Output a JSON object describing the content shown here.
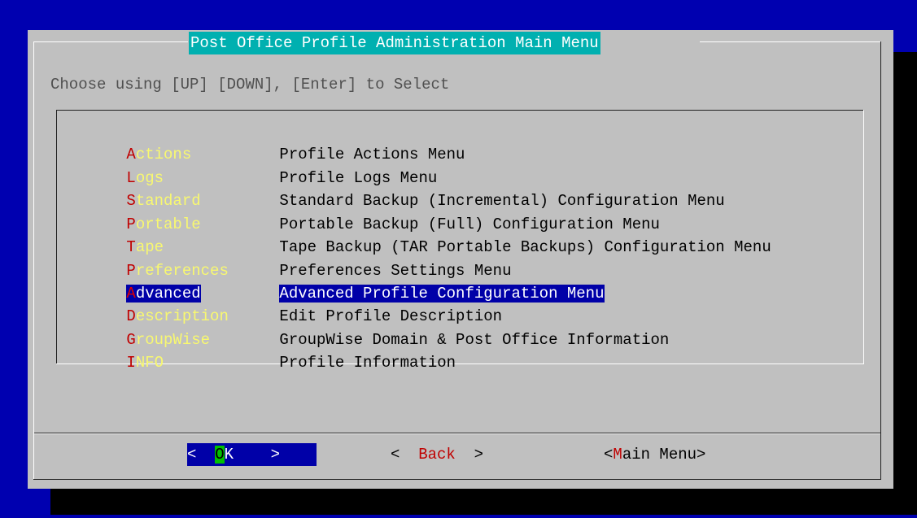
{
  "dialog": {
    "title": "Post Office Profile Administration Main Menu",
    "prompt": "Choose using [UP] [DOWN], [Enter] to Select"
  },
  "menu": {
    "selected_index": 6,
    "items": [
      {
        "hot": "A",
        "rest": "ctions",
        "desc": "Profile Actions Menu"
      },
      {
        "hot": "L",
        "rest": "ogs",
        "desc": "Profile Logs Menu"
      },
      {
        "hot": "S",
        "rest": "tandard",
        "desc": "Standard Backup (Incremental) Configuration Menu"
      },
      {
        "hot": "P",
        "rest": "ortable",
        "desc": "Portable Backup (Full) Configuration Menu"
      },
      {
        "hot": "T",
        "rest": "ape",
        "desc": "Tape Backup (TAR Portable Backups) Configuration Menu"
      },
      {
        "hot": "P",
        "rest": "references",
        "desc": "Preferences Settings Menu"
      },
      {
        "hot": "A",
        "rest": "dvanced",
        "desc": "Advanced Profile Configuration Menu"
      },
      {
        "hot": "D",
        "rest": "escription",
        "desc": "Edit Profile Description"
      },
      {
        "hot": "G",
        "rest": "roupWise",
        "desc": "GroupWise Domain & Post Office Information"
      },
      {
        "hot": "I",
        "rest": "NFO",
        "desc": "Profile Information"
      }
    ]
  },
  "buttons": {
    "ok": {
      "left": "<  ",
      "hot": "O",
      "rest": "K",
      "right": "    >"
    },
    "back": {
      "left": "<  ",
      "hot": "B",
      "rest": "ack",
      "right": "  >"
    },
    "main_menu": {
      "left": "<",
      "hot": "M",
      "rest": "ain Menu",
      "right": ">"
    }
  },
  "colors": {
    "screen_bg": "#0000b0",
    "dialog_bg": "#c0c0c0",
    "title_bg": "#00b0b0",
    "selection_bg": "#0000a8",
    "hotkey": "#c00000",
    "tag_text": "#f8f870",
    "ok_hotkey_bg": "#00c000"
  }
}
